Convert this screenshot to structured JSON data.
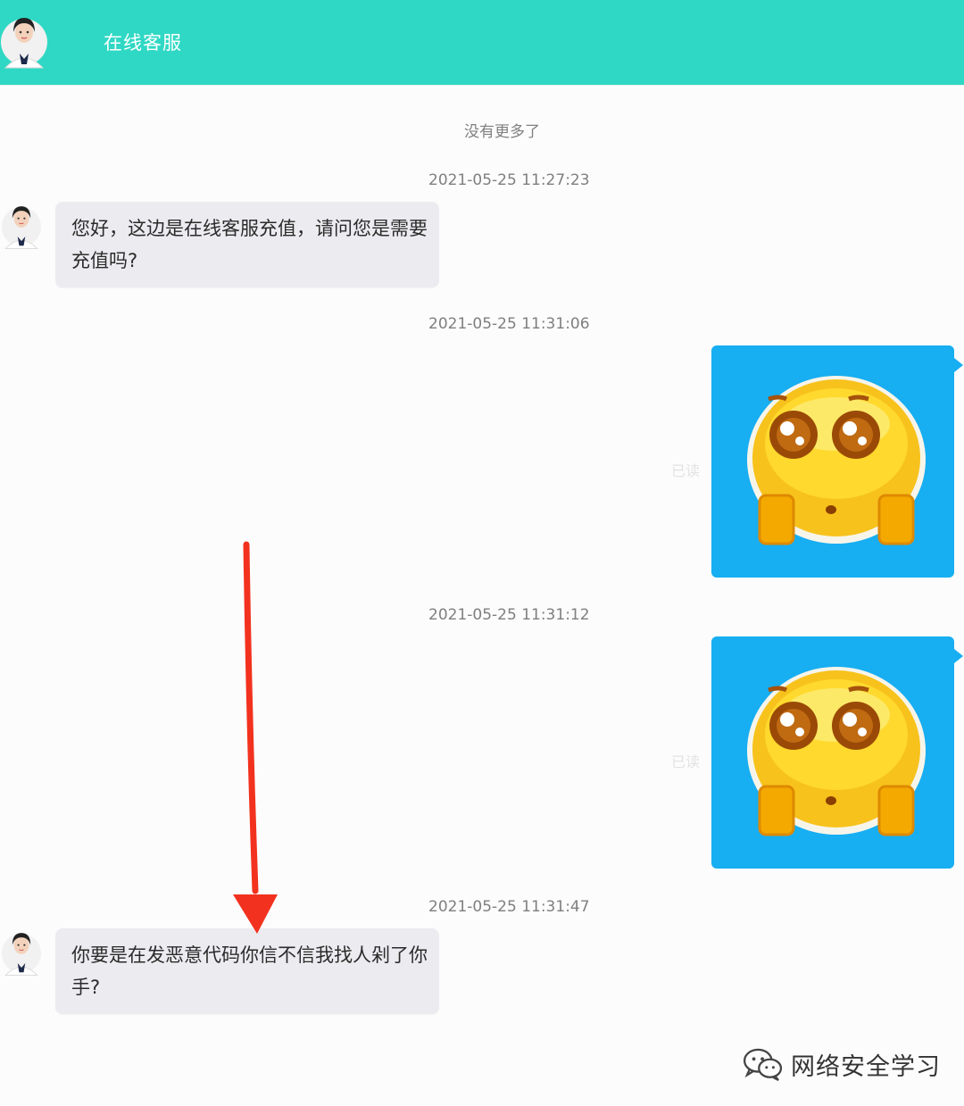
{
  "header": {
    "title": "在线客服"
  },
  "system": {
    "no_more": "没有更多了"
  },
  "messages": {
    "m1": {
      "time": "2021-05-25 11:27:23",
      "text": "您好，这边是在线客服充值，请问您是需要充值吗?"
    },
    "m2": {
      "time": "2021-05-25 11:31:06",
      "read": "已读"
    },
    "m3": {
      "time": "2021-05-25 11:31:12",
      "read": "已读"
    },
    "m4": {
      "time": "2021-05-25 11:31:47",
      "text": "你要是在发恶意代码你信不信我找人剁了你手?"
    }
  },
  "watermark": {
    "text": "网络安全学习"
  },
  "colors": {
    "header": "#2fd8c4",
    "image_bubble": "#17aef2",
    "arrow": "#f2321e"
  }
}
